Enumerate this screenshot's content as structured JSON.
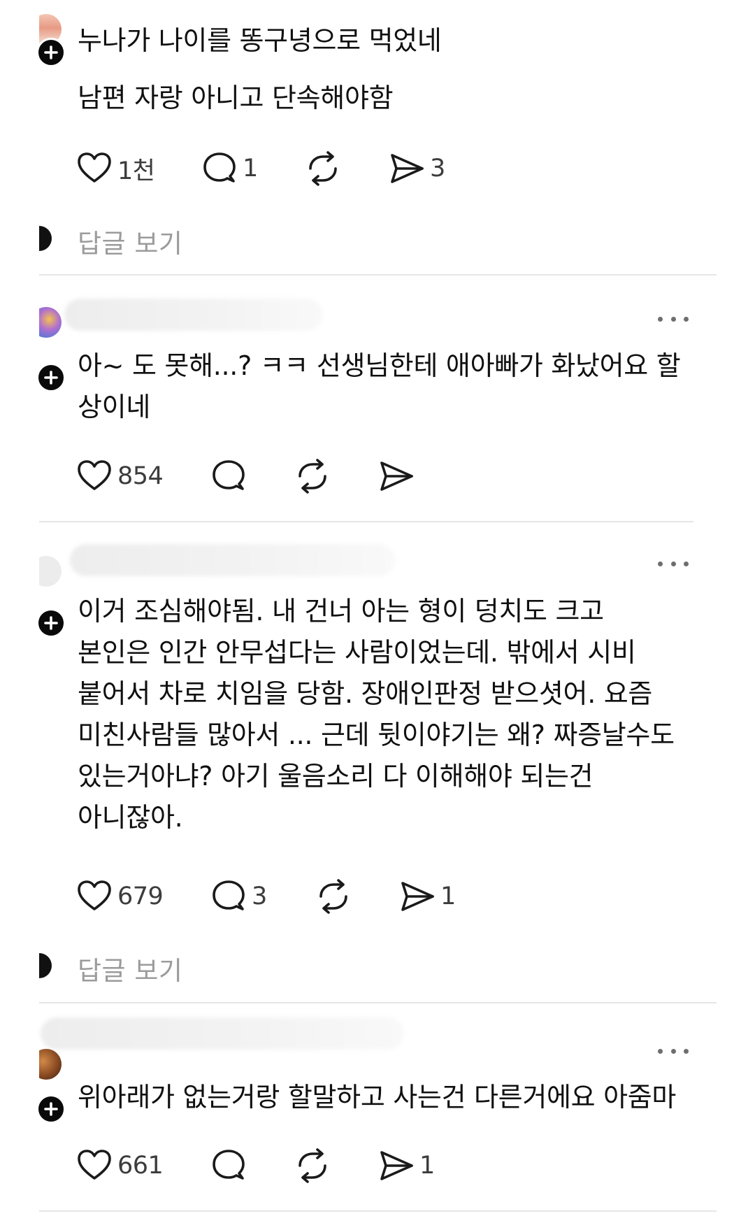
{
  "posts": [
    {
      "lines": [
        "누나가 나이를 똥구녕으로 먹었네",
        "남편 자랑 아니고 단속해야함"
      ],
      "likes": "1천",
      "comments": "1",
      "reposts": "",
      "shares": "3",
      "view_replies": "답글 보기"
    },
    {
      "lines": [
        "아~ 도 못해...? ㅋㅋ 선생님한테 애아빠가 화났어요 할",
        "상이네"
      ],
      "likes": "854",
      "comments": "",
      "reposts": "",
      "shares": ""
    },
    {
      "lines": [
        "이거 조심해야됨.  내 건너 아는 형이  덩치도 크고",
        "본인은 인간 안무섭다는 사람이었는데.  밖에서 시비",
        "붙어서 차로 치임을 당함. 장애인판정 받으셧어.  요즘",
        "미친사람들 많아서 ... 근데 뒷이야기는  왜? 짜증날수도",
        "있는거아냐?  아기 울음소리  다 이해해야 되는건",
        "아니잖아."
      ],
      "likes": "679",
      "comments": "3",
      "reposts": "",
      "shares": "1",
      "view_replies": "답글 보기"
    },
    {
      "lines": [
        "위아래가 없는거랑 할말하고 사는건 다른거에요 아줌마"
      ],
      "likes": "661",
      "comments": "",
      "reposts": "",
      "shares": "1"
    }
  ],
  "icons": {
    "like": "heart-icon",
    "comment": "comment-bubble-icon",
    "repost": "repost-icon",
    "share": "send-icon",
    "follow": "plus-icon",
    "more": "more-icon"
  },
  "colors": {
    "text": "#101010",
    "muted": "#9b9b9b",
    "count": "#3c3c3c",
    "divider": "#e6e6e6",
    "badge": "#0a0a0a"
  }
}
